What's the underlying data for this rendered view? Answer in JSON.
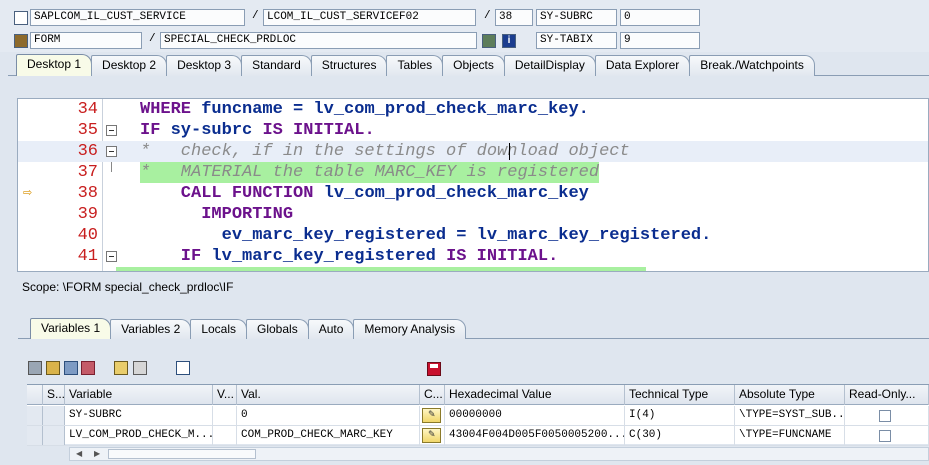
{
  "header": {
    "row1": {
      "program": "SAPLCOM_IL_CUST_SERVICE",
      "include": "LCOM_IL_CUST_SERVICEF02",
      "line": "38",
      "sysvar": "SY-SUBRC",
      "sysval": "0"
    },
    "row2": {
      "type": "FORM",
      "name": "SPECIAL_CHECK_PRDLOC",
      "sysvar": "SY-TABIX",
      "sysval": "9"
    },
    "separator": "/"
  },
  "desktop_tabs": [
    "Desktop 1",
    "Desktop 2",
    "Desktop 3",
    "Standard",
    "Structures",
    "Tables",
    "Objects",
    "DetailDisplay",
    "Data Explorer",
    "Break./Watchpoints"
  ],
  "code": {
    "lines": [
      {
        "no": "34",
        "parts": [
          {
            "t": "      WHERE ",
            "c": "kw"
          },
          {
            "t": "funcname",
            "c": "id"
          },
          {
            "t": " = ",
            "c": "id"
          },
          {
            "t": "lv_com_prod_check_marc_key.",
            "c": "id"
          }
        ]
      },
      {
        "no": "35",
        "parts": [
          {
            "t": "IF ",
            "c": "kw"
          },
          {
            "t": "sy-subrc ",
            "c": "id"
          },
          {
            "t": "IS INITIAL.",
            "c": "kw"
          }
        ]
      },
      {
        "no": "36",
        "parts": [
          {
            "t": "*   check, if in the settings of download object",
            "c": "cm"
          }
        ]
      },
      {
        "no": "37",
        "parts": [
          {
            "t": "*   MATERIAL the table MARC_KEY is registered",
            "c": "cm"
          }
        ]
      },
      {
        "no": "38",
        "parts": [
          {
            "t": "    CALL FUNCTION ",
            "c": "kw"
          },
          {
            "t": "lv_com_prod_check_marc_key",
            "c": "id"
          }
        ]
      },
      {
        "no": "39",
        "parts": [
          {
            "t": "      IMPORTING",
            "c": "kw"
          }
        ]
      },
      {
        "no": "40",
        "parts": [
          {
            "t": "        ev_marc_key_registered = lv_marc_key_registered.",
            "c": "id"
          }
        ]
      },
      {
        "no": "41",
        "parts": [
          {
            "t": "    IF ",
            "c": "kw"
          },
          {
            "t": "lv_marc_key_registered ",
            "c": "id"
          },
          {
            "t": "IS INITIAL.",
            "c": "kw"
          }
        ]
      }
    ]
  },
  "scope": "Scope: \\FORM special_check_prdloc\\IF",
  "var_tabs": [
    "Variables 1",
    "Variables 2",
    "Locals",
    "Globals",
    "Auto",
    "Memory Analysis"
  ],
  "grid": {
    "headers": [
      "S...",
      "Variable",
      "V...",
      "Val.",
      "C...",
      "Hexadecimal Value",
      "Technical Type",
      "Absolute Type",
      "Read-Only..."
    ],
    "rows": [
      {
        "variable": "SY-SUBRC",
        "value": "0",
        "hex": "00000000",
        "tech": "I(4)",
        "abs": "\\TYPE=SYST_SUB..."
      },
      {
        "variable": "LV_COM_PROD_CHECK_M...",
        "value": "COM_PROD_CHECK_MARC_KEY",
        "hex": "43004F004D005F0050005200...",
        "tech": "C(30)",
        "abs": "\\TYPE=FUNCNAME"
      }
    ]
  }
}
